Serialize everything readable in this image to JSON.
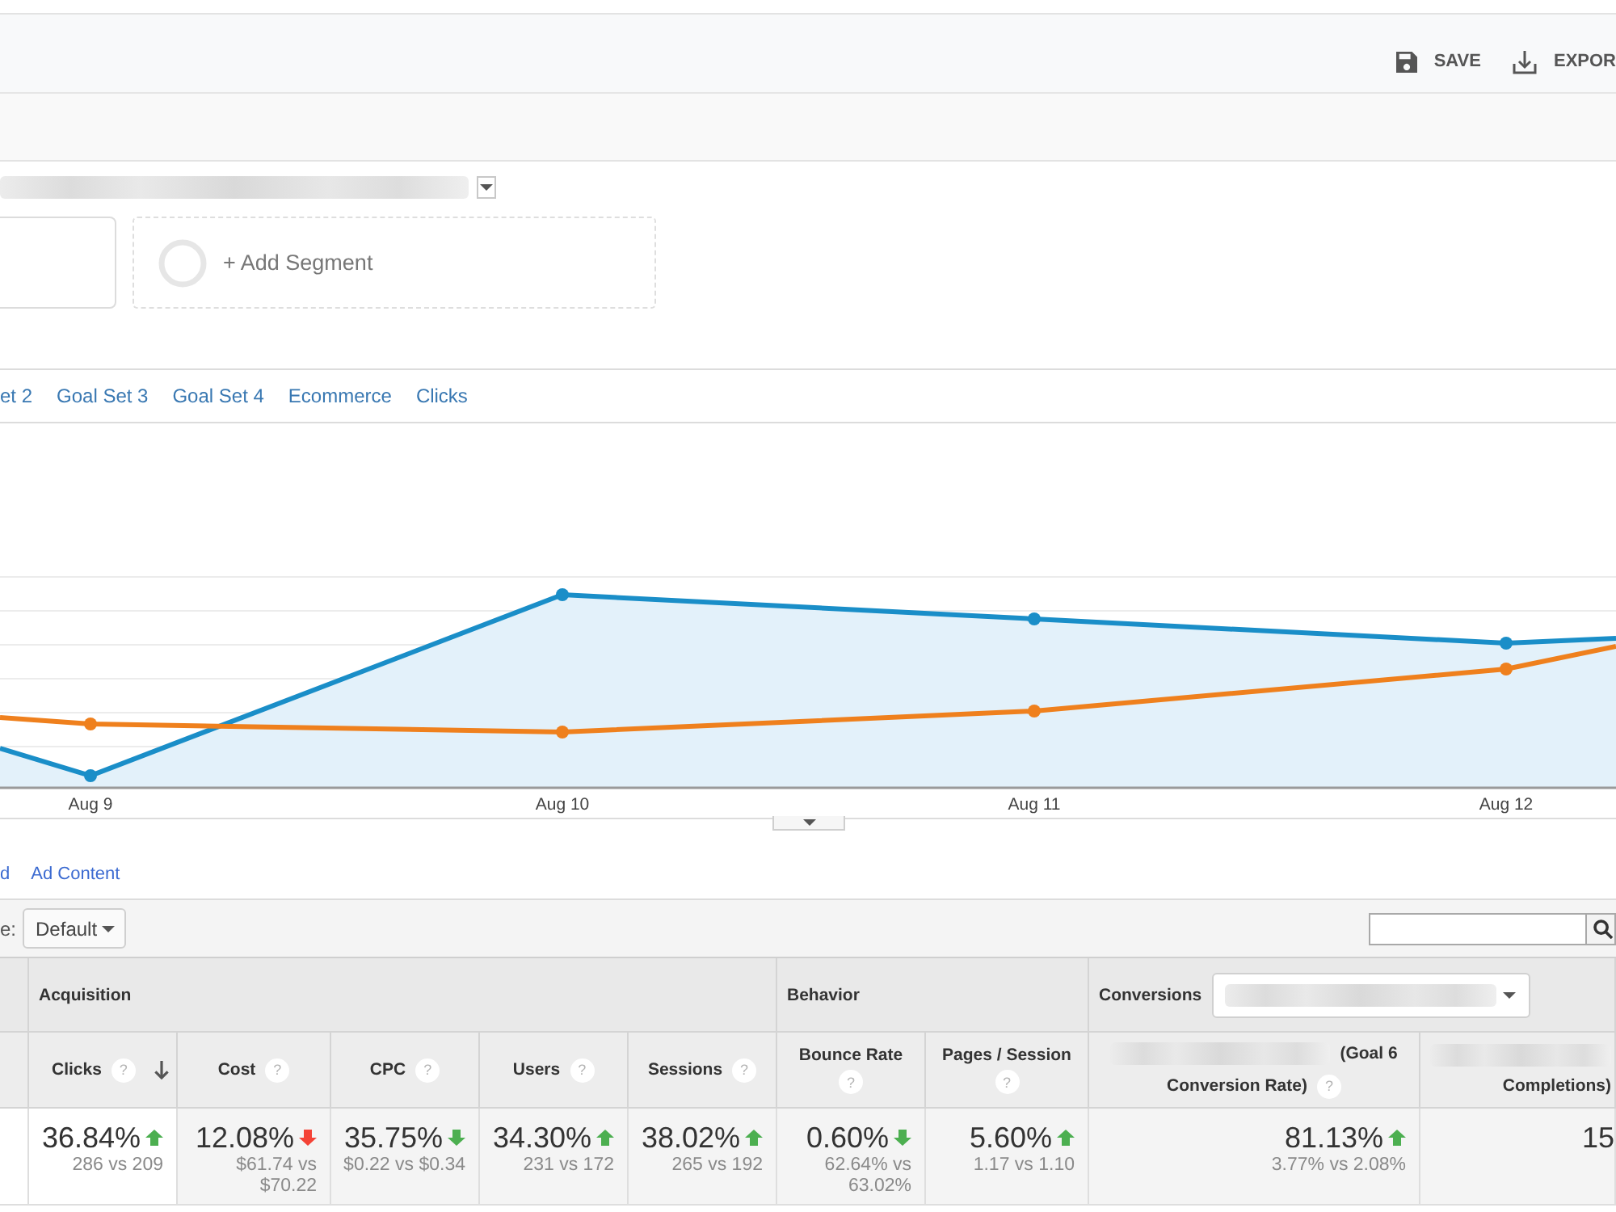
{
  "toolbar": {
    "buttons": [
      {
        "label": "SAVE",
        "kind": "save"
      },
      {
        "label": "EXPOR",
        "kind": "export"
      }
    ]
  },
  "segments": {
    "add_segment": "+ Add Segment"
  },
  "explorer_tabs": [
    "et 2",
    "Goal Set 3",
    "Goal Set 4",
    "Ecommerce",
    "Clicks"
  ],
  "chart": {
    "x_labels": [
      "Aug 9",
      "Aug 10",
      "Aug 11",
      "Aug 12"
    ]
  },
  "secondary_links": [
    "d",
    "Ad Content"
  ],
  "table_toolbar": {
    "label": "e:",
    "dropdown": "Default"
  },
  "table": {
    "groups": [
      {
        "label": "Acquisition",
        "kind": "plain",
        "columns": [
          {
            "label": "Clicks",
            "help": "?",
            "sorted": true,
            "total": {
              "value": "36.84%",
              "increase": true,
              "color": "#4caf50",
              "compare": "286 vs 209"
            }
          },
          {
            "label": "Cost",
            "help": "?",
            "sorted": false,
            "total": {
              "value": "12.08%",
              "increase": false,
              "color": "#f44336",
              "compare": "$61.74 vs $70.22"
            }
          },
          {
            "label": "CPC",
            "help": "?",
            "sorted": false,
            "total": {
              "value": "35.75%",
              "increase": false,
              "color": "#4caf50",
              "compare": "$0.22 vs $0.34"
            }
          },
          {
            "label": "Users",
            "help": "?",
            "sorted": false,
            "total": {
              "value": "34.30%",
              "increase": true,
              "color": "#4caf50",
              "compare": "231 vs 172"
            }
          },
          {
            "label": "Sessions",
            "help": "?",
            "sorted": false,
            "total": {
              "value": "38.02%",
              "increase": true,
              "color": "#4caf50",
              "compare": "265 vs 192"
            }
          }
        ]
      },
      {
        "label": "Behavior",
        "kind": "plain",
        "columns": [
          {
            "label": "Bounce Rate",
            "help": "?",
            "sorted": false,
            "total": {
              "value": "0.60%",
              "increase": false,
              "color": "#4caf50",
              "compare": "62.64% vs 63.02%"
            }
          },
          {
            "label": "Pages / Session",
            "help": "?",
            "sorted": false,
            "total": {
              "value": "5.60%",
              "increase": true,
              "color": "#4caf50",
              "compare": "1.17 vs 1.10"
            }
          }
        ]
      },
      {
        "label": "Conversions",
        "kind": "selector",
        "columns": [
          {
            "kind": "redacted",
            "first_line": "(Goal 6",
            "label": "Conversion Rate)",
            "help": "?",
            "sorted": false,
            "total": {
              "value": "81.13%",
              "increase": true,
              "color": "#4caf50",
              "compare": "3.77% vs 2.08%"
            }
          },
          {
            "kind": "redacted",
            "label": "Completions)",
            "sorted": false,
            "total": {
              "value": "15"
            }
          }
        ]
      }
    ]
  }
}
